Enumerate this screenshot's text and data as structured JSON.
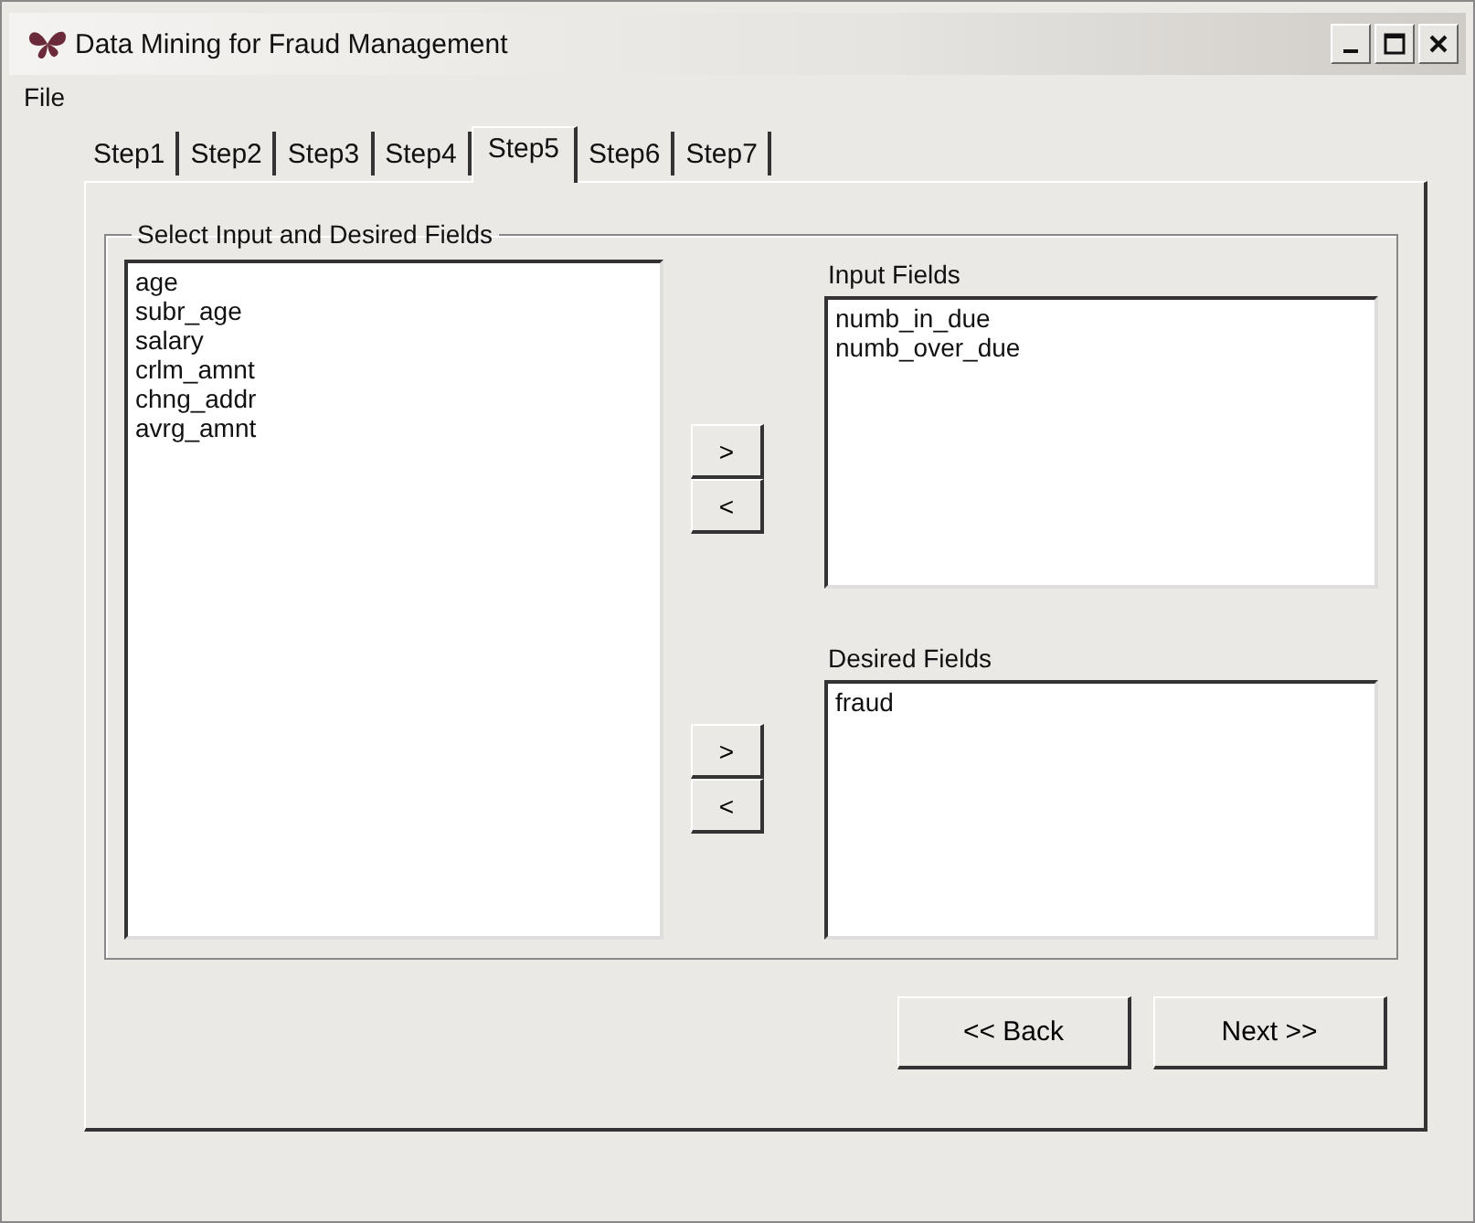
{
  "window": {
    "title": "Data Mining for Fraud Management"
  },
  "menu": [
    "File"
  ],
  "tabs": [
    {
      "label": "Step1",
      "selected": false
    },
    {
      "label": "Step2",
      "selected": false
    },
    {
      "label": "Step3",
      "selected": false
    },
    {
      "label": "Step4",
      "selected": false
    },
    {
      "label": "Step5",
      "selected": true
    },
    {
      "label": "Step6",
      "selected": false
    },
    {
      "label": "Step7",
      "selected": false
    }
  ],
  "group": {
    "title": "Select Input and Desired Fields",
    "available_fields": [
      "age",
      "subr_age",
      "salary",
      "crlm_amnt",
      "chng_addr",
      "avrg_amnt"
    ],
    "input_fields": {
      "label": "Input Fields",
      "items": [
        "numb_in_due",
        "numb_over_due"
      ],
      "add": ">",
      "remove": "<"
    },
    "desired_fields": {
      "label": "Desired Fields",
      "items": [
        "fraud"
      ],
      "add": ">",
      "remove": "<"
    }
  },
  "buttons": [
    "<< Back",
    "Next >>"
  ]
}
